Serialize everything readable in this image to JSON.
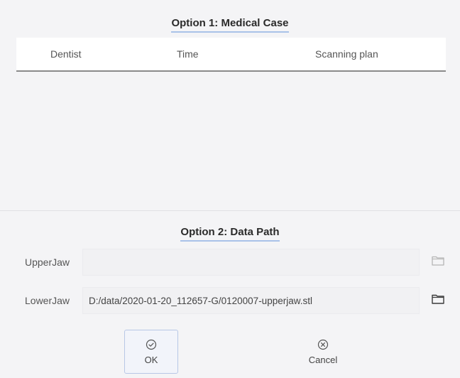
{
  "option1": {
    "title": "Option 1:  Medical Case",
    "columns": [
      "Dentist",
      "Time",
      "Scanning plan"
    ],
    "rows": []
  },
  "option2": {
    "title": "Option 2:  Data Path",
    "upper_jaw": {
      "label": "UpperJaw",
      "value": ""
    },
    "lower_jaw": {
      "label": "LowerJaw",
      "value": "D:/data/2020-01-20_112657-G/0120007-upperjaw.stl"
    }
  },
  "buttons": {
    "ok_label": "OK",
    "cancel_label": "Cancel"
  },
  "icons": {
    "ok": "check-circle-icon",
    "cancel": "x-circle-icon",
    "browse": "folder-icon"
  },
  "colors": {
    "accent_underline": "#a9c2e8",
    "ok_border": "#b8c7e6",
    "background": "#f4f4f6"
  }
}
